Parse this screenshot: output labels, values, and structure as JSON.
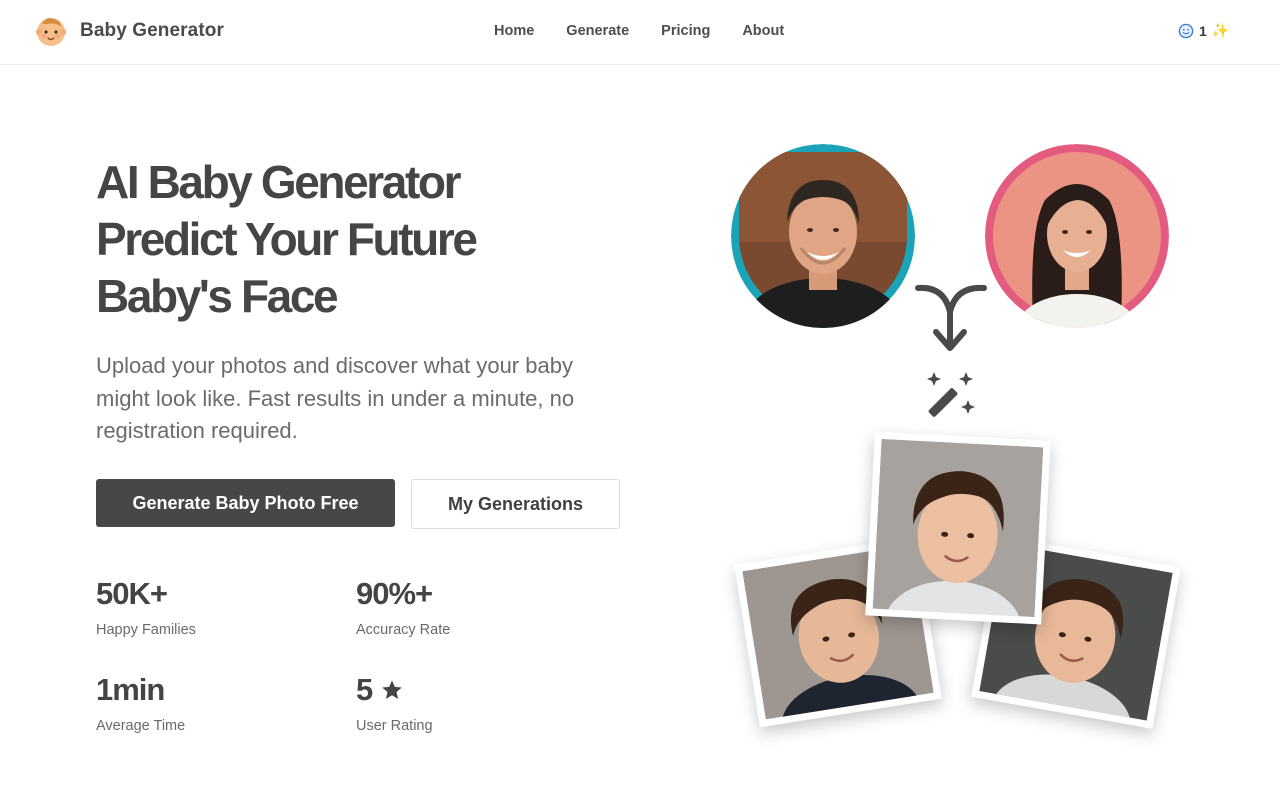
{
  "nav": {
    "brand": "Baby Generator",
    "links": [
      "Home",
      "Generate",
      "Pricing",
      "About"
    ],
    "credits": "1",
    "credits_sparkle": "✨"
  },
  "hero": {
    "title_lines": [
      "AI Baby Generator",
      "Predict Your Future",
      "Baby's Face"
    ],
    "subtitle": "Upload your photos and discover what your baby might look like. Fast results in under a minute, no registration required.",
    "primary_button": "Generate Baby Photo Free",
    "secondary_button": "My Generations"
  },
  "stats": [
    {
      "value": "50K+",
      "label": "Happy Families"
    },
    {
      "value": "90%+",
      "label": "Accuracy Rate"
    },
    {
      "value": "1min",
      "label": "Average Time"
    },
    {
      "value": "5",
      "label": "User Rating"
    }
  ],
  "icons": {
    "logo": "baby-face-icon",
    "credits": "smiley-icon",
    "rating": "star-icon",
    "merge": "merge-arrow-icon",
    "magic": "magic-wand-icon"
  },
  "colors": {
    "father_ring": "#1ba3b8",
    "mother_ring": "#e45b80",
    "primary_button": "#474747",
    "text_dark": "#454545"
  }
}
